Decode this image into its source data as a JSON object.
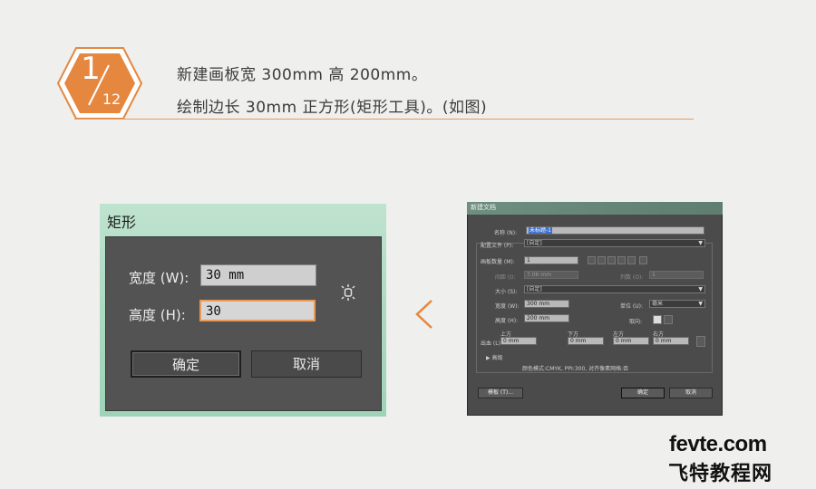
{
  "header": {
    "step_current": "1",
    "step_total": "12",
    "line1": "新建画板宽 300mm 高 200mm。",
    "line2": "绘制边长 30mm 正方形(矩形工具)。(如图)",
    "accent_color": "#e5873f"
  },
  "rect_dialog": {
    "title": "矩形",
    "width_label": "宽度 (W):",
    "width_value": "30 mm",
    "height_label": "高度 (H):",
    "height_value": "30",
    "ok_label": "确定",
    "cancel_label": "取消",
    "link_icon": "chain-link-icon"
  },
  "arrow_icon": "chevron-left-icon",
  "new_doc_dialog": {
    "title": "新建文档",
    "name_label": "名称 (N):",
    "name_value": "未标题-1",
    "profile_label": "配置文件 (P):",
    "profile_value": "[自定]",
    "artboards_label": "画板数量 (M):",
    "artboards_value": "1",
    "spacing_label": "间距 (I):",
    "spacing_value": "7.06 mm",
    "columns_label": "列数 (O):",
    "columns_value": "1",
    "size_label": "大小 (S):",
    "size_value": "[自定]",
    "width_label": "宽度 (W):",
    "width_value": "300 mm",
    "units_label": "单位 (U):",
    "units_value": "毫米",
    "height_label": "高度 (H):",
    "height_value": "200 mm",
    "orientation_label": "取向:",
    "bleed_label": "出血 (L):",
    "bleed_top_label": "上方",
    "bleed_bottom_label": "下方",
    "bleed_left_label": "左方",
    "bleed_right_label": "右方",
    "bleed_top": "0 mm",
    "bleed_bottom": "0 mm",
    "bleed_left": "0 mm",
    "bleed_right": "0 mm",
    "advanced_label": "高级",
    "summary": "颜色模式:CMYK, PPI:300, 对齐像素网格:否",
    "template_btn": "模板 (T)...",
    "ok_btn": "确定",
    "cancel_btn": "取消"
  },
  "watermark": {
    "line1": "fevte.com",
    "line2": "飞特教程网"
  }
}
